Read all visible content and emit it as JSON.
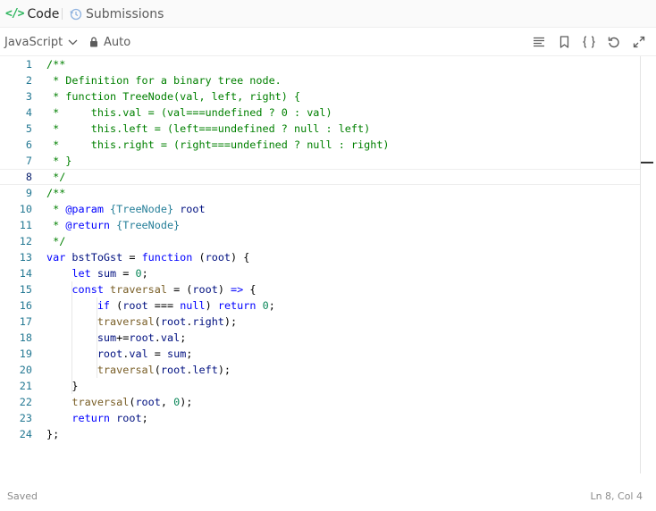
{
  "tabs": {
    "code_label": "Code",
    "submissions_label": "Submissions"
  },
  "toolbar": {
    "language": "JavaScript",
    "mode": "Auto",
    "tools": [
      "list-icon",
      "bookmark-icon",
      "braces-icon",
      "undo-icon",
      "expand-icon"
    ]
  },
  "editor": {
    "active_line": 8,
    "line_numbers": [
      "1",
      "2",
      "3",
      "4",
      "5",
      "6",
      "7",
      "8",
      "9",
      "10",
      "11",
      "12",
      "13",
      "14",
      "15",
      "16",
      "17",
      "18",
      "19",
      "20",
      "21",
      "22",
      "23",
      "24"
    ],
    "lines": [
      {
        "segments": [
          {
            "t": "/**",
            "c": "com"
          }
        ]
      },
      {
        "segments": [
          {
            "t": " * Definition for a binary tree node.",
            "c": "com"
          }
        ]
      },
      {
        "segments": [
          {
            "t": " * function TreeNode(val, left, right) {",
            "c": "com"
          }
        ]
      },
      {
        "segments": [
          {
            "t": " *     this.val = (val===undefined ? 0 : val)",
            "c": "com"
          }
        ]
      },
      {
        "segments": [
          {
            "t": " *     this.left = (left===undefined ? null : left)",
            "c": "com"
          }
        ]
      },
      {
        "segments": [
          {
            "t": " *     this.right = (right===undefined ? null : right)",
            "c": "com"
          }
        ]
      },
      {
        "segments": [
          {
            "t": " * }",
            "c": "com"
          }
        ]
      },
      {
        "segments": [
          {
            "t": " */",
            "c": "com"
          }
        ]
      },
      {
        "segments": [
          {
            "t": "/**",
            "c": "com"
          }
        ]
      },
      {
        "segments": [
          {
            "t": " * ",
            "c": "com"
          },
          {
            "t": "@param",
            "c": "tag"
          },
          {
            "t": " ",
            "c": "com"
          },
          {
            "t": "{TreeNode}",
            "c": "type"
          },
          {
            "t": " ",
            "c": "com"
          },
          {
            "t": "root",
            "c": "var"
          }
        ]
      },
      {
        "segments": [
          {
            "t": " * ",
            "c": "com"
          },
          {
            "t": "@return",
            "c": "tag"
          },
          {
            "t": " ",
            "c": "com"
          },
          {
            "t": "{TreeNode}",
            "c": "type"
          }
        ]
      },
      {
        "segments": [
          {
            "t": " */",
            "c": "com"
          }
        ]
      },
      {
        "segments": [
          {
            "t": "var",
            "c": "kw"
          },
          {
            "t": " ",
            "c": ""
          },
          {
            "t": "bstToGst",
            "c": "var"
          },
          {
            "t": " = ",
            "c": ""
          },
          {
            "t": "function",
            "c": "kw"
          },
          {
            "t": " (",
            "c": ""
          },
          {
            "t": "root",
            "c": "var"
          },
          {
            "t": ") {",
            "c": ""
          }
        ]
      },
      {
        "segments": [
          {
            "t": "    ",
            "c": ""
          },
          {
            "t": "let",
            "c": "kw"
          },
          {
            "t": " ",
            "c": ""
          },
          {
            "t": "sum",
            "c": "var"
          },
          {
            "t": " = ",
            "c": ""
          },
          {
            "t": "0",
            "c": "num"
          },
          {
            "t": ";",
            "c": ""
          }
        ]
      },
      {
        "segments": [
          {
            "t": "    ",
            "c": ""
          },
          {
            "t": "const",
            "c": "kw"
          },
          {
            "t": " ",
            "c": ""
          },
          {
            "t": "traversal",
            "c": "fn"
          },
          {
            "t": " = (",
            "c": ""
          },
          {
            "t": "root",
            "c": "var"
          },
          {
            "t": ") ",
            "c": ""
          },
          {
            "t": "=>",
            "c": "kw"
          },
          {
            "t": " {",
            "c": ""
          }
        ]
      },
      {
        "segments": [
          {
            "t": "        ",
            "c": ""
          },
          {
            "t": "if",
            "c": "kw"
          },
          {
            "t": " (",
            "c": ""
          },
          {
            "t": "root",
            "c": "var"
          },
          {
            "t": " === ",
            "c": ""
          },
          {
            "t": "null",
            "c": "kw"
          },
          {
            "t": ") ",
            "c": ""
          },
          {
            "t": "return",
            "c": "kw"
          },
          {
            "t": " ",
            "c": ""
          },
          {
            "t": "0",
            "c": "num"
          },
          {
            "t": ";",
            "c": ""
          }
        ]
      },
      {
        "segments": [
          {
            "t": "        ",
            "c": ""
          },
          {
            "t": "traversal",
            "c": "fn"
          },
          {
            "t": "(",
            "c": ""
          },
          {
            "t": "root",
            "c": "var"
          },
          {
            "t": ".",
            "c": ""
          },
          {
            "t": "right",
            "c": "var"
          },
          {
            "t": ");",
            "c": ""
          }
        ]
      },
      {
        "segments": [
          {
            "t": "        ",
            "c": ""
          },
          {
            "t": "sum",
            "c": "var"
          },
          {
            "t": "+=",
            "c": ""
          },
          {
            "t": "root",
            "c": "var"
          },
          {
            "t": ".",
            "c": ""
          },
          {
            "t": "val",
            "c": "var"
          },
          {
            "t": ";",
            "c": ""
          }
        ]
      },
      {
        "segments": [
          {
            "t": "        ",
            "c": ""
          },
          {
            "t": "root",
            "c": "var"
          },
          {
            "t": ".",
            "c": ""
          },
          {
            "t": "val",
            "c": "var"
          },
          {
            "t": " = ",
            "c": ""
          },
          {
            "t": "sum",
            "c": "var"
          },
          {
            "t": ";",
            "c": ""
          }
        ]
      },
      {
        "segments": [
          {
            "t": "        ",
            "c": ""
          },
          {
            "t": "traversal",
            "c": "fn"
          },
          {
            "t": "(",
            "c": ""
          },
          {
            "t": "root",
            "c": "var"
          },
          {
            "t": ".",
            "c": ""
          },
          {
            "t": "left",
            "c": "var"
          },
          {
            "t": ");",
            "c": ""
          }
        ]
      },
      {
        "segments": [
          {
            "t": "    }",
            "c": ""
          }
        ]
      },
      {
        "segments": [
          {
            "t": "    ",
            "c": ""
          },
          {
            "t": "traversal",
            "c": "fn"
          },
          {
            "t": "(",
            "c": ""
          },
          {
            "t": "root",
            "c": "var"
          },
          {
            "t": ", ",
            "c": ""
          },
          {
            "t": "0",
            "c": "num"
          },
          {
            "t": ");",
            "c": ""
          }
        ]
      },
      {
        "segments": [
          {
            "t": "    ",
            "c": ""
          },
          {
            "t": "return",
            "c": "kw"
          },
          {
            "t": " ",
            "c": ""
          },
          {
            "t": "root",
            "c": "var"
          },
          {
            "t": ";",
            "c": ""
          }
        ]
      },
      {
        "segments": [
          {
            "t": "};",
            "c": ""
          }
        ]
      }
    ]
  },
  "status": {
    "saved": "Saved",
    "position": "Ln 8, Col 4"
  },
  "colors": {
    "accent_green": "#2db55d",
    "comment": "#008000",
    "keyword": "#0000ff",
    "number": "#098658",
    "function": "#795e26",
    "variable": "#001080",
    "type": "#267f99",
    "line_number": "#237893"
  }
}
